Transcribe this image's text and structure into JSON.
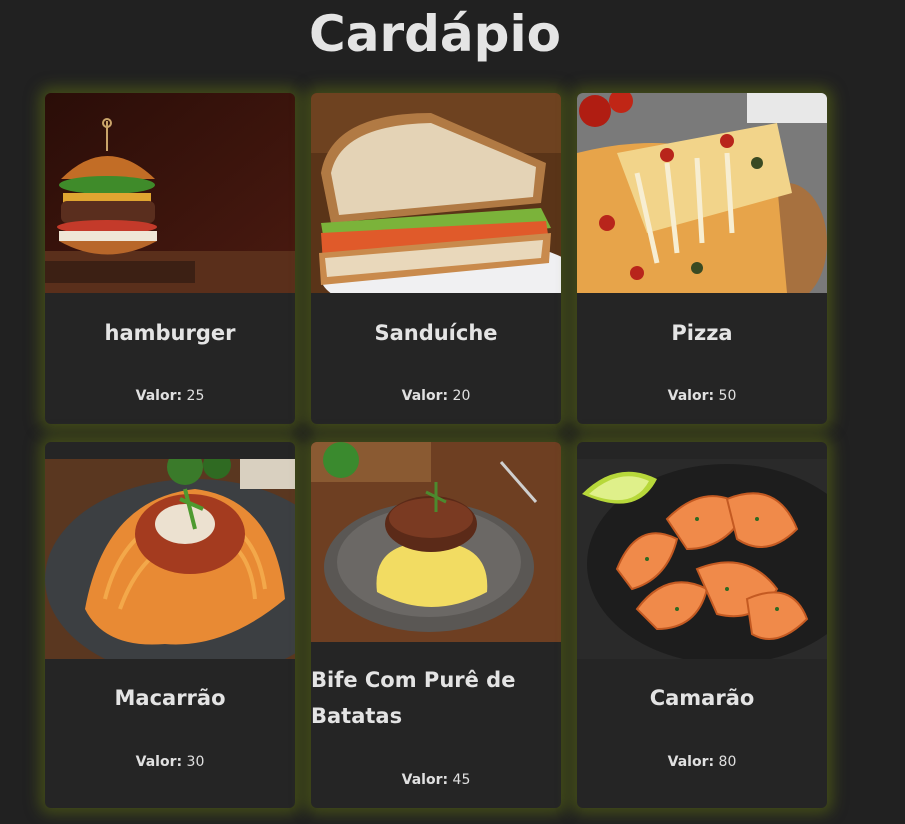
{
  "page": {
    "title": "Cardápio"
  },
  "price_label": "Valor:",
  "items": [
    {
      "name": "hamburger",
      "price": "25",
      "image": "hamburger-photo"
    },
    {
      "name": "Sanduíche",
      "price": "20",
      "image": "sandwich-photo"
    },
    {
      "name": "Pizza",
      "price": "50",
      "image": "pizza-photo"
    },
    {
      "name": "Macarrão",
      "price": "30",
      "image": "spaghetti-photo"
    },
    {
      "name": "Bife Com Purê de Batatas",
      "price": "45",
      "image": "steak-mashed-potatoes-photo"
    },
    {
      "name": "Camarão",
      "price": "80",
      "image": "shrimp-photo"
    }
  ],
  "colors": {
    "background": "#212121",
    "card": "#252525",
    "glow": "#5c6e12",
    "text": "#e4e4e4"
  }
}
